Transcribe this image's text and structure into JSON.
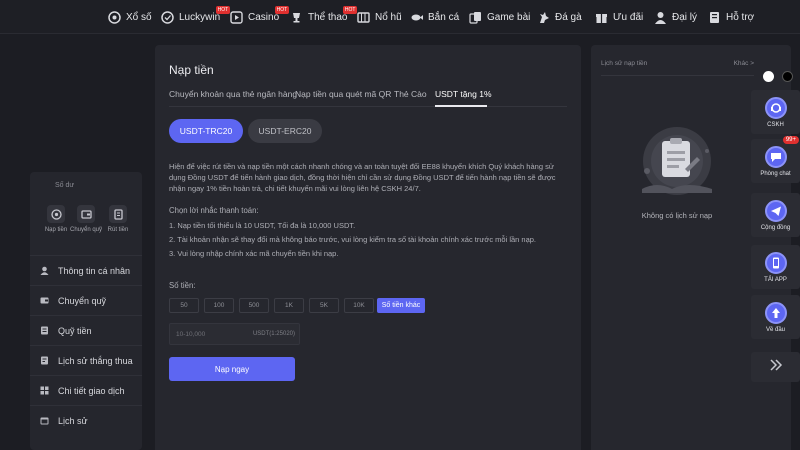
{
  "nav": {
    "items": [
      {
        "label": "Xổ số",
        "icon": "lottery-icon"
      },
      {
        "label": "Luckywin",
        "icon": "luckywin-icon",
        "badge": "HOT"
      },
      {
        "label": "Casino",
        "icon": "casino-icon",
        "badge": "HOT"
      },
      {
        "label": "Thể thao",
        "icon": "sports-icon",
        "badge": "HOT"
      },
      {
        "label": "Nổ hũ",
        "icon": "slot-icon"
      },
      {
        "label": "Bắn cá",
        "icon": "fish-icon"
      },
      {
        "label": "Game bài",
        "icon": "cards-icon"
      },
      {
        "label": "Đá gà",
        "icon": "rooster-icon"
      },
      {
        "label": "Ưu đãi",
        "icon": "gift-icon"
      },
      {
        "label": "Đại lý",
        "icon": "agent-icon"
      },
      {
        "label": "Hỗ trợ",
        "icon": "support-icon"
      }
    ]
  },
  "sidebar": {
    "balance_label": "Số dư",
    "quick": [
      {
        "label": "Nạp tiền",
        "icon": "deposit-icon"
      },
      {
        "label": "Chuyển quỹ",
        "icon": "transfer-icon"
      },
      {
        "label": "Rút tiền",
        "icon": "withdraw-icon"
      }
    ],
    "items": [
      {
        "label": "Thông tin cá nhân",
        "icon": "user-icon"
      },
      {
        "label": "Chuyển quỹ",
        "icon": "wallet-icon"
      },
      {
        "label": "Quỹ tiền",
        "icon": "fund-icon"
      },
      {
        "label": "Lịch sử thắng thua",
        "icon": "history-icon"
      },
      {
        "label": "Chi tiết giao dịch",
        "icon": "transaction-icon"
      },
      {
        "label": "Lịch sử",
        "icon": "calendar-icon"
      }
    ]
  },
  "main": {
    "title": "Nạp tiền",
    "tabs": [
      {
        "label": "Chuyển khoản qua thẻ ngân hàng"
      },
      {
        "label": "Nạp tiền qua quét mã QR"
      },
      {
        "label": "Thẻ Cào"
      },
      {
        "label": "USDT tặng 1%",
        "active": true
      }
    ],
    "networks": [
      "USDT-TRC20",
      "USDT-ERC20"
    ],
    "description_lines": [
      "Hiện để việc rút tiền và nạp tiền một cách nhanh chóng và an toàn tuyệt đối EE88 khuyến khích Quý khách hàng sử",
      "dụng Đồng USDT để tiến hành giao dịch, đồng thời hiện chỉ cần sử dụng Đồng USDT để tiến hành nạp tiền sẽ được",
      "nhận ngay 1% tiền hoàn trả, chi tiết khuyến mãi vui lòng liên hệ CSKH 24/7."
    ],
    "rules_title": "Chọn lời nhắc thanh toán:",
    "rules": [
      "1. Nạp tiền tối thiểu là 10 USDT, Tối đa là 10,000 USDT.",
      "2. Tài khoản nhận sẽ thay đổi mà không báo trước, vui lòng kiểm tra số tài khoản chính xác trước mỗi lần nạp.",
      "3. Vui lòng nhập chính xác mã chuyển tiền khi nạp."
    ],
    "amount_label": "Số tiền:",
    "amounts": [
      "50",
      "100",
      "500",
      "1K",
      "5K",
      "10K"
    ],
    "other_amount": "Số tiền khác",
    "amount_placeholder": "10-10,000",
    "amount_unit": "USDT(1:25020)",
    "submit_label": "Nạp ngay"
  },
  "history": {
    "title": "Lịch sử nạp tiền",
    "other": "Khác >",
    "empty_text": "Không có lịch sử nạp"
  },
  "right_bar": {
    "dots": [
      "#ffffff",
      "#000000"
    ],
    "buttons": [
      {
        "label": "CSKH",
        "icon": "support-agent-icon"
      },
      {
        "label": "Phòng chat",
        "icon": "chat-icon",
        "badge": "99+"
      },
      {
        "label": "Cộng đồng",
        "icon": "telegram-icon"
      },
      {
        "label": "TẢI APP",
        "icon": "phone-icon"
      },
      {
        "label": "Về đầu",
        "icon": "arrow-up-icon"
      }
    ]
  },
  "colors": {
    "accent": "#5d66f2",
    "background": "#1c1d23",
    "panel": "#26272e",
    "hot": "#e0302f"
  }
}
